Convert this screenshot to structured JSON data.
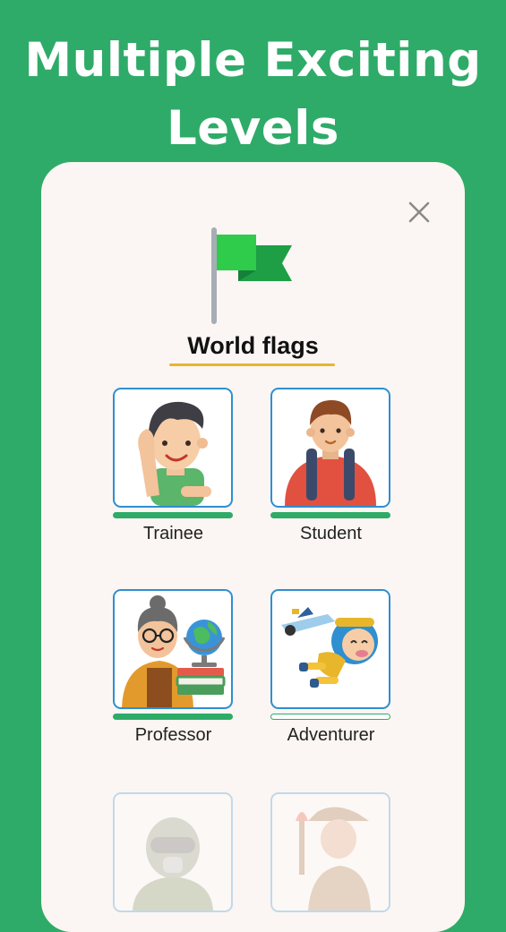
{
  "hero": {
    "line1": "Multiple Exciting",
    "line2": "Levels"
  },
  "dialog": {
    "title": "World flags",
    "close_icon": "close-icon",
    "flag_icon": "green-flag-icon"
  },
  "levels": [
    {
      "label": "Trainee",
      "progress": 1.0,
      "state": "unlocked"
    },
    {
      "label": "Student",
      "progress": 1.0,
      "state": "unlocked"
    },
    {
      "label": "Professor",
      "progress": 1.0,
      "state": "unlocked"
    },
    {
      "label": "Adventurer",
      "progress": 0.0,
      "state": "unlocked"
    },
    {
      "label": "",
      "progress": 0.0,
      "state": "locked"
    },
    {
      "label": "",
      "progress": 0.0,
      "state": "locked"
    }
  ],
  "colors": {
    "background": "#2EAB68",
    "card": "#FBF6F3",
    "frame_border": "#2E8FD1",
    "underline": "#E8B62B",
    "progress": "#2EAB68"
  }
}
